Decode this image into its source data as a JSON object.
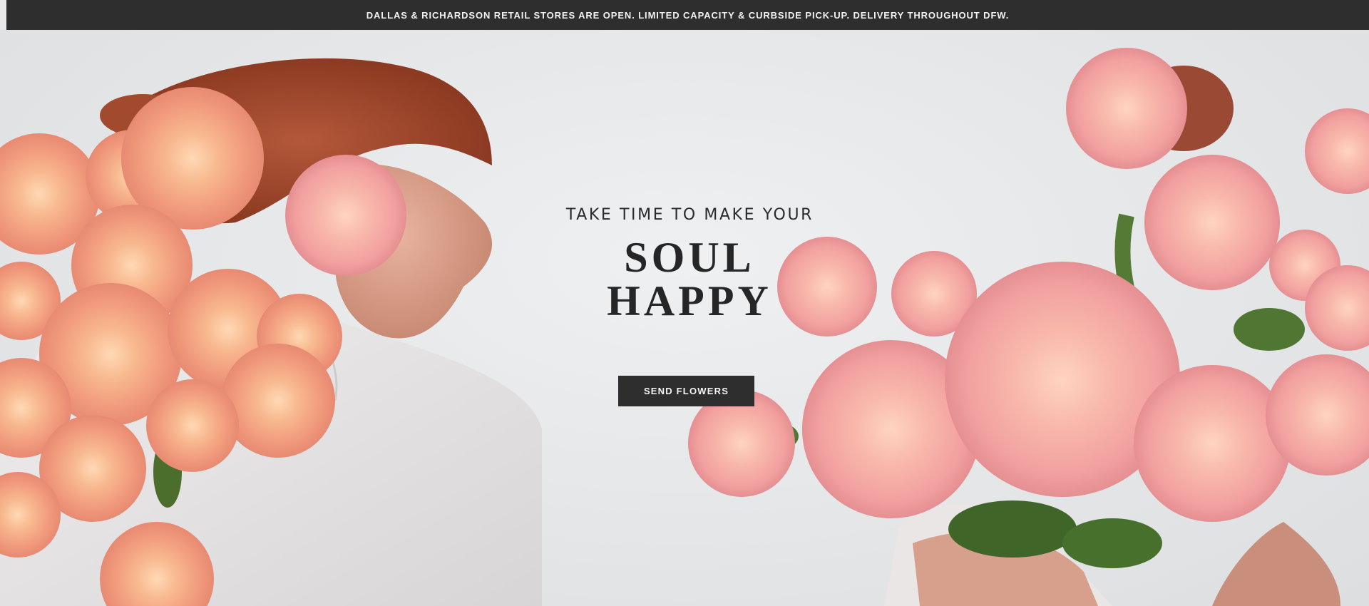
{
  "announcement": {
    "text": "DALLAS & RICHARDSON RETAIL STORES ARE OPEN. LIMITED CAPACITY & CURBSIDE PICK-UP. DELIVERY THROUGHOUT DFW."
  },
  "hero": {
    "kicker": "TAKE TIME TO MAKE YOUR",
    "headline_line1": "SOUL",
    "headline_line2": "HAPPY",
    "cta_label": "SEND FLOWERS"
  },
  "colors": {
    "bar_background": "#2e2e2e",
    "cta_background": "#2e2e2e",
    "page_background": "#e6e8ea",
    "rose_peach": "#f4a585",
    "rose_pink": "#f5b0ad"
  }
}
